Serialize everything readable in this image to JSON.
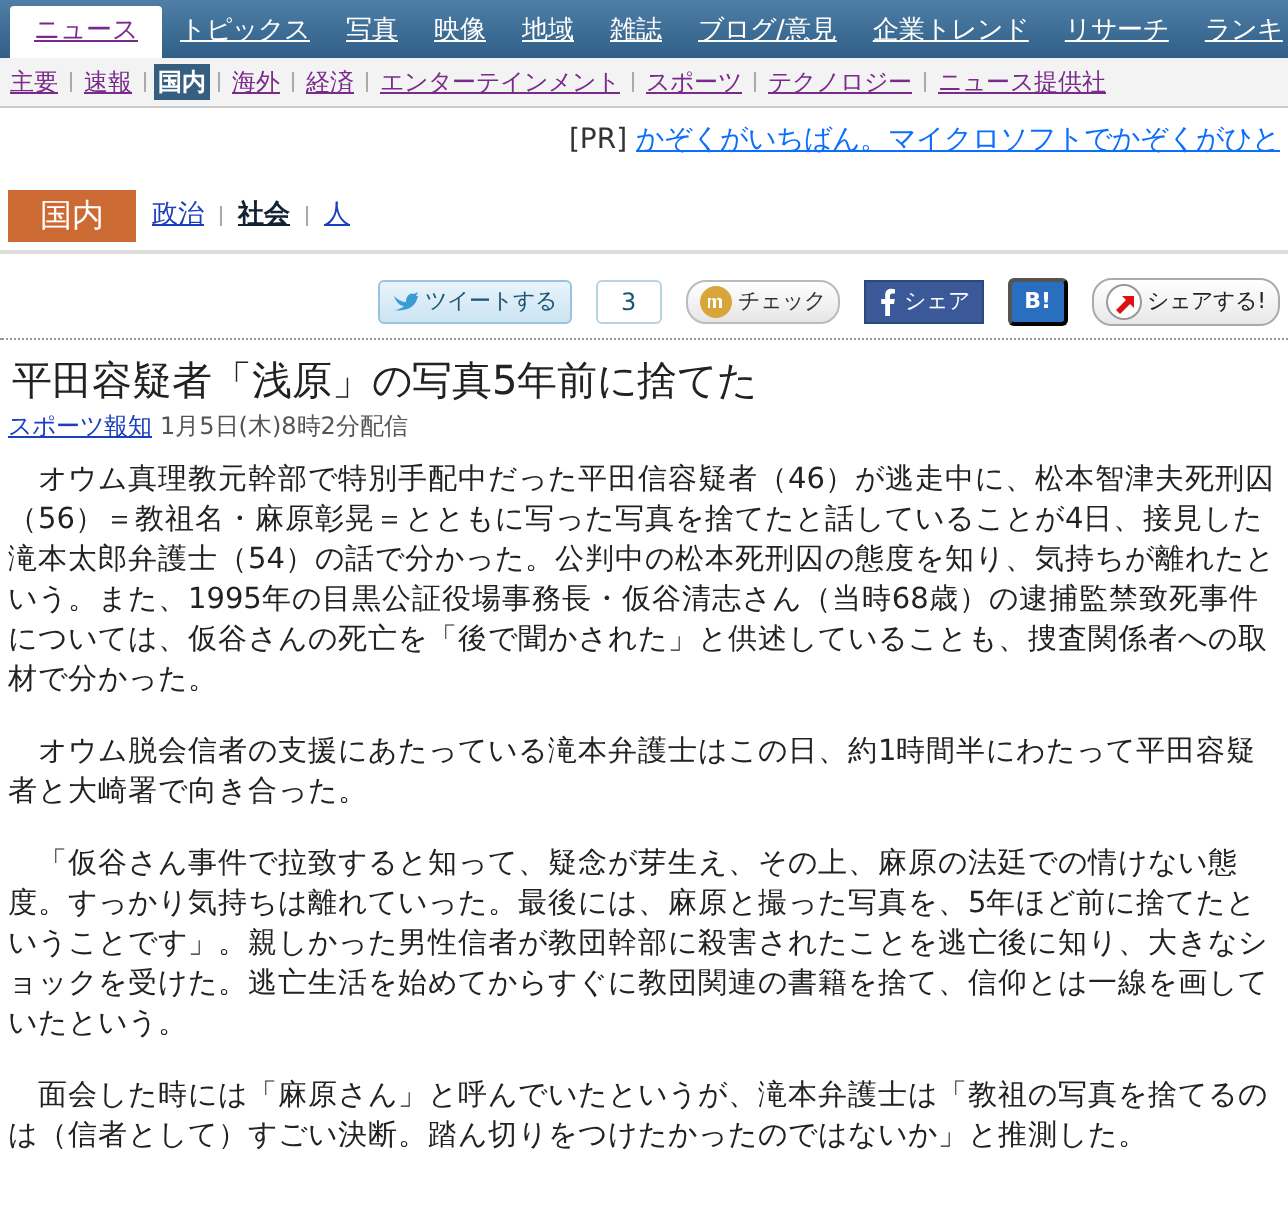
{
  "top_nav": [
    {
      "label": "ニュース",
      "selected": true
    },
    {
      "label": "トピックス",
      "selected": false
    },
    {
      "label": "写真",
      "selected": false
    },
    {
      "label": "映像",
      "selected": false
    },
    {
      "label": "地域",
      "selected": false
    },
    {
      "label": "雑誌",
      "selected": false
    },
    {
      "label": "ブログ/意見",
      "selected": false
    },
    {
      "label": "企業トレンド",
      "selected": false
    },
    {
      "label": "リサーチ",
      "selected": false
    },
    {
      "label": "ランキ",
      "selected": false
    }
  ],
  "sub_nav": [
    {
      "label": "主要",
      "selected": false
    },
    {
      "label": "速報",
      "selected": false
    },
    {
      "label": "国内",
      "selected": true
    },
    {
      "label": "海外",
      "selected": false
    },
    {
      "label": "経済",
      "selected": false
    },
    {
      "label": "エンターテインメント",
      "selected": false
    },
    {
      "label": "スポーツ",
      "selected": false
    },
    {
      "label": "テクノロジー",
      "selected": false
    },
    {
      "label": "ニュース提供社",
      "selected": false
    }
  ],
  "pr": {
    "tag": "[PR]",
    "link": "かぞくがいちばん。マイクロソフトでかぞくがひと"
  },
  "section": {
    "title": "国内",
    "items": [
      {
        "label": "政治",
        "selected": false
      },
      {
        "label": "社会",
        "selected": true
      },
      {
        "label": "人",
        "selected": false
      }
    ]
  },
  "share": [
    {
      "kind": "tweet",
      "label": "ツイートする",
      "count": "3"
    },
    {
      "kind": "mixi",
      "label": "チェック"
    },
    {
      "kind": "facebook",
      "label": "シェア"
    },
    {
      "kind": "hatena",
      "label": "B!"
    },
    {
      "kind": "shareto",
      "label": "シェアする!"
    }
  ],
  "article": {
    "title": "平田容疑者「浅原」の写真5年前に捨てた",
    "source": "スポーツ報知",
    "date": "1月5日(木)8時2分配信",
    "paragraphs": [
      "　オウム真理教元幹部で特別手配中だった平田信容疑者（46）が逃走中に、松本智津夫死刑囚（56）＝教祖名・麻原彰晃＝とともに写った写真を捨てたと話していることが4日、接見した滝本太郎弁護士（54）の話で分かった。公判中の松本死刑囚の態度を知り、気持ちが離れたという。また、1995年の目黒公証役場事務長・仮谷清志さん（当時68歳）の逮捕監禁致死事件については、仮谷さんの死亡を「後で聞かされた」と供述していることも、捜査関係者への取材で分かった。",
      "　オウム脱会信者の支援にあたっている滝本弁護士はこの日、約1時間半にわたって平田容疑者と大崎署で向き合った。",
      "　「仮谷さん事件で拉致すると知って、疑念が芽生え、その上、麻原の法廷での情けない態度。すっかり気持ちは離れていった。最後には、麻原と撮った写真を、5年ほど前に捨てたということです」。親しかった男性信者が教団幹部に殺害されたことを逃亡後に知り、大きなショックを受けた。逃亡生活を始めてからすぐに教団関連の書籍を捨て、信仰とは一線を画していたという。",
      "　面会した時には「麻原さん」と呼んでいたというが、滝本弁護士は「教祖の写真を捨てるのは（信者として）すごい決断。踏ん切りをつけたかったのではないか」と推測した。"
    ]
  }
}
